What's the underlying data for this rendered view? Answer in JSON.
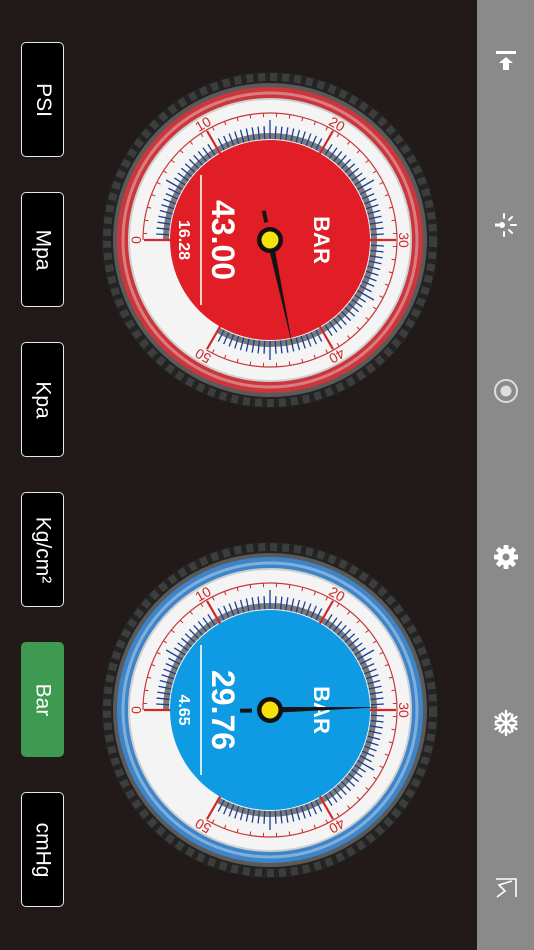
{
  "units": [
    {
      "label": "PSI",
      "active": false
    },
    {
      "label": "Mpa",
      "active": false
    },
    {
      "label": "Kpa",
      "active": false
    },
    {
      "label": "Kg/cm²",
      "active": false
    },
    {
      "label": "Bar",
      "active": true
    },
    {
      "label": "cmHg",
      "active": false
    }
  ],
  "gauges": [
    {
      "name": "red",
      "unit_label": "BAR",
      "value": "43.00",
      "secondary": "16.28",
      "needle_value": 43,
      "colors": {
        "face": "#e11d25",
        "ring": "#c9363c"
      }
    },
    {
      "name": "blue",
      "unit_label": "BAR",
      "value": "29.76",
      "secondary": "4.65",
      "needle_value": 29.76,
      "colors": {
        "face": "#0e9be3",
        "ring": "#3d84c9"
      }
    }
  ],
  "scale": {
    "min": 0,
    "max": 50,
    "labels": [
      "0",
      "10",
      "20",
      "30",
      "40",
      "50"
    ]
  },
  "sidebar": {
    "icons": [
      "exit-icon",
      "brightness-icon",
      "record-icon",
      "settings-icon",
      "snowflake-icon",
      "chart-icon"
    ]
  }
}
